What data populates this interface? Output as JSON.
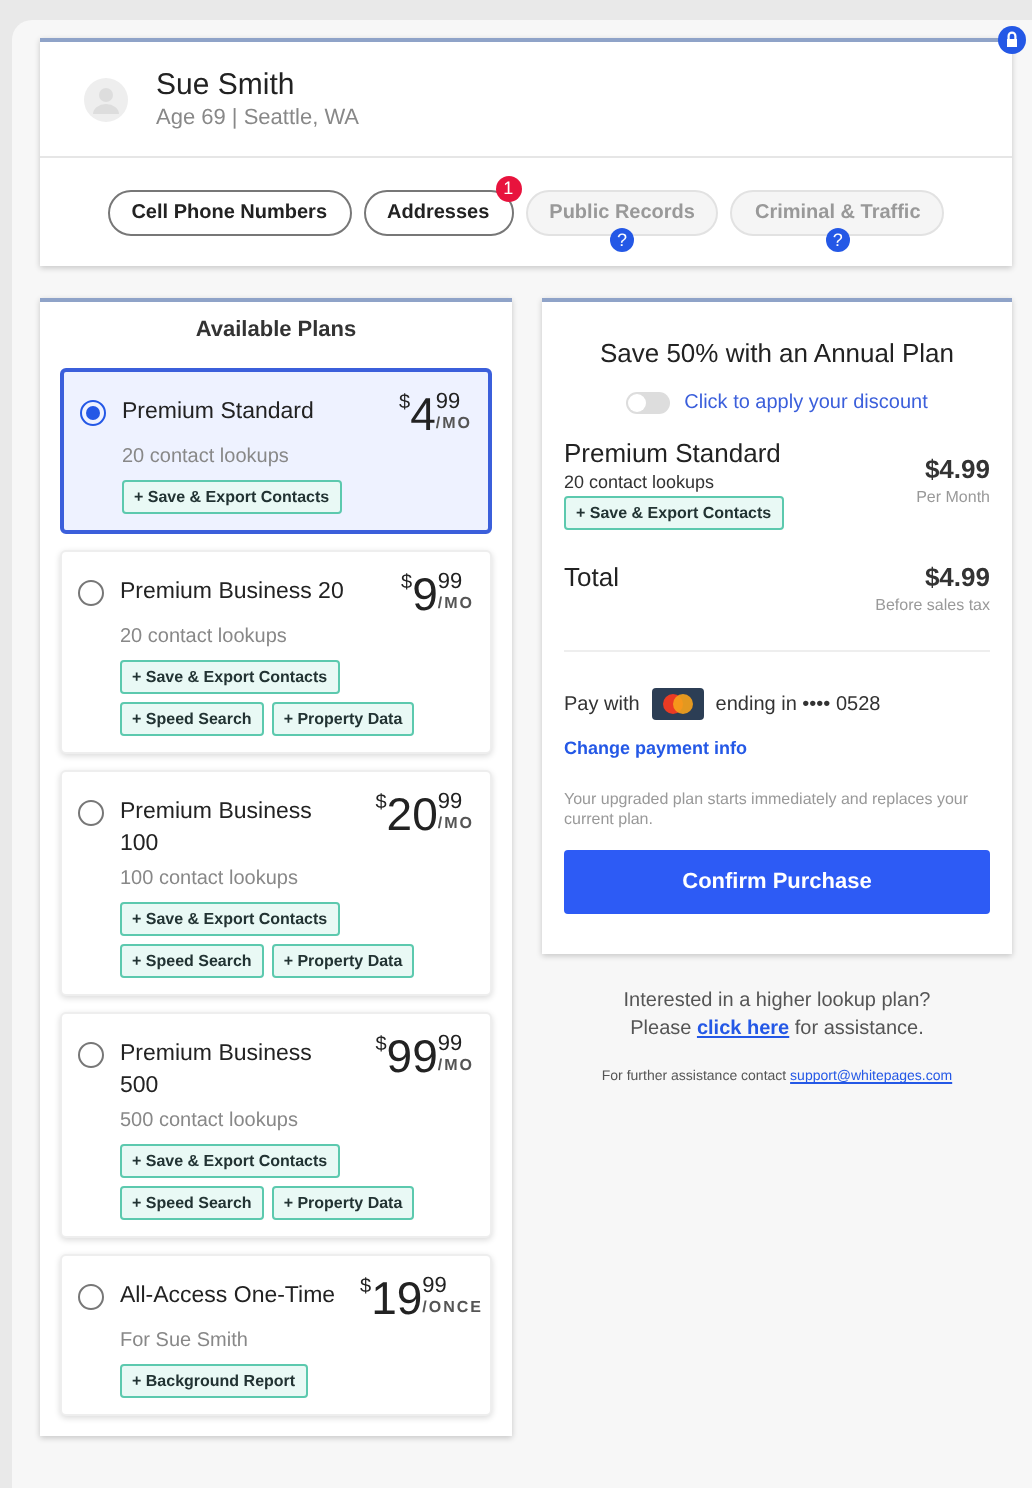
{
  "profile": {
    "name": "Sue Smith",
    "details": "Age 69 | Seattle, WA"
  },
  "tabs": [
    {
      "label": "Cell Phone Numbers",
      "disabled": false
    },
    {
      "label": "Addresses",
      "disabled": false,
      "badge": "1"
    },
    {
      "label": "Public Records",
      "disabled": true,
      "help": "?"
    },
    {
      "label": "Criminal & Traffic",
      "disabled": true,
      "help": "?"
    }
  ],
  "plans_title": "Available Plans",
  "plans": [
    {
      "name": "Premium Standard",
      "currency": "$",
      "dollars": "4",
      "cents": "99",
      "period": "/MO",
      "detail": "20 contact lookups",
      "selected": true,
      "features": [
        "+ Save & Export Contacts"
      ]
    },
    {
      "name": "Premium Business 20",
      "currency": "$",
      "dollars": "9",
      "cents": "99",
      "period": "/MO",
      "detail": "20 contact lookups",
      "selected": false,
      "features": [
        "+ Save & Export Contacts",
        "+ Speed Search",
        "+ Property Data"
      ]
    },
    {
      "name": "Premium Business 100",
      "currency": "$",
      "dollars": "20",
      "cents": "99",
      "period": "/MO",
      "detail": "100 contact lookups",
      "selected": false,
      "features": [
        "+ Save & Export Contacts",
        "+ Speed Search",
        "+ Property Data"
      ]
    },
    {
      "name": "Premium Business 500",
      "currency": "$",
      "dollars": "99",
      "cents": "99",
      "period": "/MO",
      "detail": "500 contact lookups",
      "selected": false,
      "features": [
        "+ Save & Export Contacts",
        "+ Speed Search",
        "+ Property Data"
      ]
    },
    {
      "name": "All-Access One-Time",
      "currency": "$",
      "dollars": "19",
      "cents": "99",
      "period": "/ONCE",
      "detail": "For Sue Smith",
      "selected": false,
      "features": [
        "+ Background Report"
      ]
    }
  ],
  "checkout": {
    "title": "Save 50% with an Annual Plan",
    "discount_toggle": {
      "label": "Click to apply your discount",
      "on": false
    },
    "plan_name": "Premium Standard",
    "plan_detail": "20 contact lookups",
    "plan_feature": "+ Save & Export Contacts",
    "plan_price": "$4.99",
    "plan_price_note": "Per Month",
    "total_label": "Total",
    "total_price": "$4.99",
    "total_note": "Before sales tax",
    "pay_with": "Pay with",
    "card_ending": "ending in •••• 0528",
    "change_link": "Change payment info",
    "notice": "Your upgraded plan starts immediately and replaces your current plan.",
    "confirm_button": "Confirm Purchase"
  },
  "footer": {
    "question": "Interested in a higher lookup plan?",
    "before": "Please ",
    "link": "click here",
    "after": " for assistance.",
    "contact": "For further assistance contact ",
    "email": "support@whitepages.com"
  }
}
